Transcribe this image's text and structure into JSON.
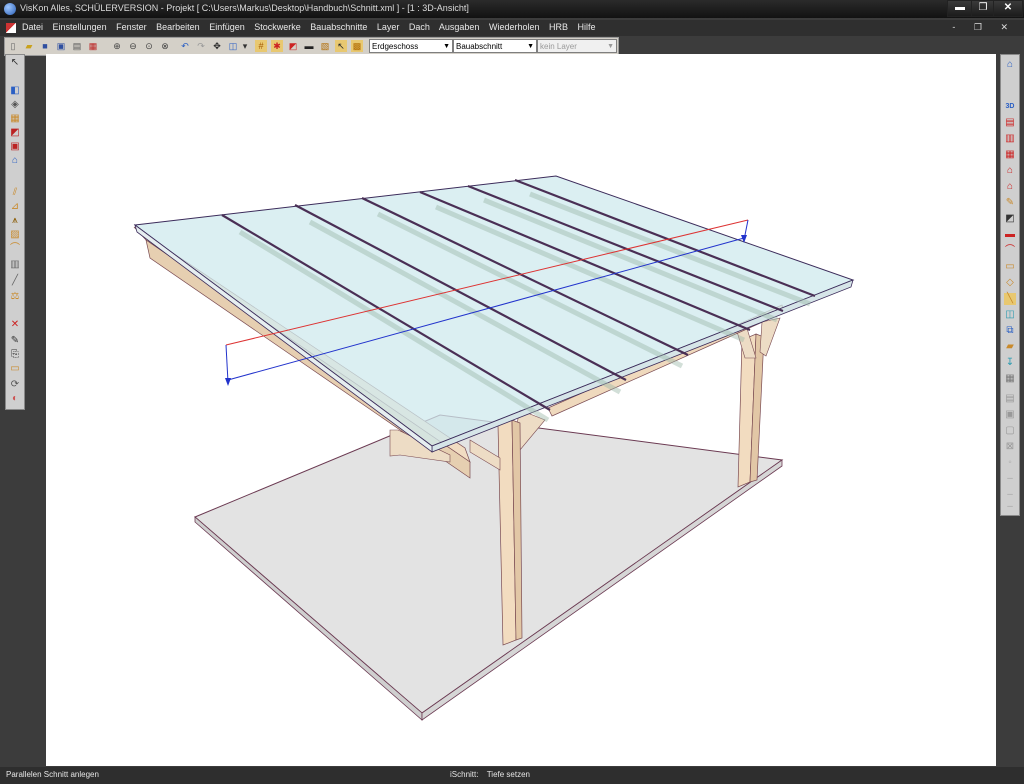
{
  "window": {
    "title": "VisKon Alles, SCHÜLERVERSION - Projekt [ C:\\Users\\Markus\\Desktop\\Handbuch\\Schnitt.xml ] - [1 : 3D-Ansicht]",
    "min_label": "▬",
    "max_label": "❐",
    "close_label": "✕"
  },
  "menu": {
    "items": [
      "Datei",
      "Einstellungen",
      "Fenster",
      "Bearbeiten",
      "Einfügen",
      "Stockwerke",
      "Bauabschnitte",
      "Layer",
      "Dach",
      "Ausgaben",
      "Wiederholen",
      "HRB",
      "Hilfe"
    ],
    "mdi_controls": "- ❐ ✕"
  },
  "toolbar": {
    "floor_select": "Erdgeschoss",
    "section_select": "Bauabschnitt",
    "layer_select": "kein Layer"
  },
  "right_toolbar": {
    "label_3d": "3D"
  },
  "status": {
    "left": "Parallelen Schnitt anlegen",
    "mode": "iSchnitt:",
    "action": "Tiefe setzen"
  }
}
